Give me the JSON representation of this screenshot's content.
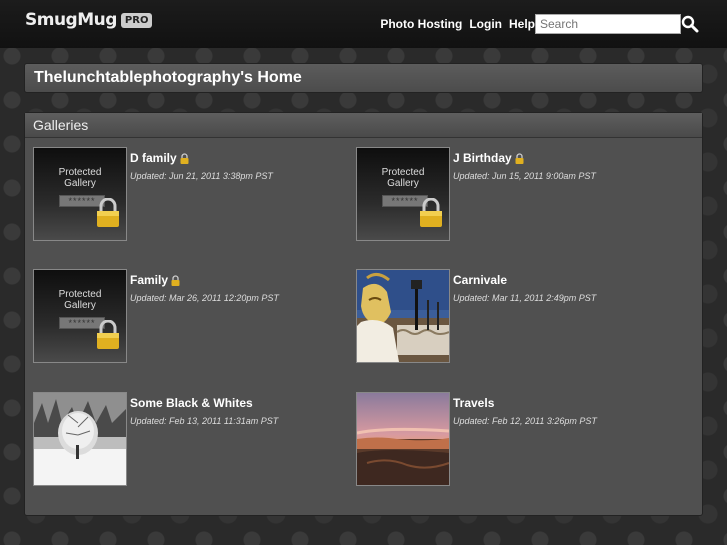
{
  "header": {
    "logo_text": "SmugMug",
    "logo_badge": "PRO",
    "nav": [
      "Photo Hosting",
      "Login",
      "Help"
    ],
    "search_placeholder": "Search"
  },
  "home": {
    "title": "Thelunchtablephotography's Home"
  },
  "galleries": {
    "heading": "Galleries",
    "protected_label_line1": "Protected",
    "protected_label_line2": "Gallery",
    "protected_dots": "******",
    "items": [
      {
        "title": "D family",
        "updated": "Updated: Jun 21, 2011 3:38pm PST",
        "locked": true,
        "thumb": "protected"
      },
      {
        "title": "J Birthday",
        "updated": "Updated: Jun 15, 2011 9:00am PST",
        "locked": true,
        "thumb": "protected"
      },
      {
        "title": "Family",
        "updated": "Updated: Mar 26, 2011 12:20pm PST",
        "locked": true,
        "thumb": "protected"
      },
      {
        "title": "Carnivale",
        "updated": "Updated: Mar 11, 2011 2:49pm PST",
        "locked": false,
        "thumb": "carnival-photo"
      },
      {
        "title": "Some Black & Whites",
        "updated": "Updated: Feb 13, 2011 11:31am PST",
        "locked": false,
        "thumb": "snow-tree-photo"
      },
      {
        "title": "Travels",
        "updated": "Updated: Feb 12, 2011 3:26pm PST",
        "locked": false,
        "thumb": "canyon-sunset-photo"
      }
    ]
  }
}
